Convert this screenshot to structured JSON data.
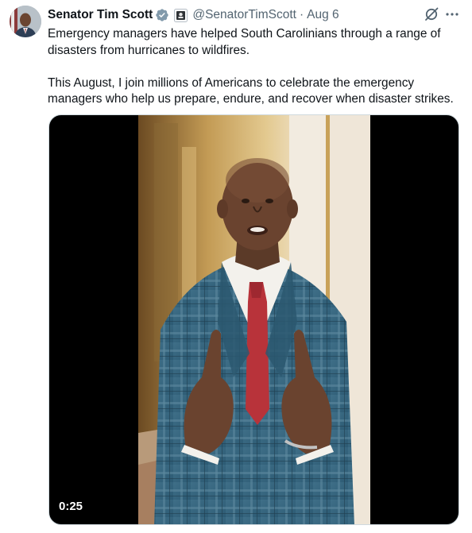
{
  "author": {
    "name": "Senator Tim Scott",
    "handle": "@SenatorTimScott",
    "separator": "·",
    "time": "Aug 6"
  },
  "tweet": {
    "paragraph1": "Emergency managers have helped South Carolinians through a range of disasters from hurricanes to wildfires.",
    "paragraph2": "This August, I join millions of Americans to celebrate the emergency managers who help us prepare, endure, and recover when disaster strikes."
  },
  "video": {
    "duration": "0:25"
  },
  "colors": {
    "verified": "#829aab",
    "text": "#0f1419",
    "secondary": "#536471"
  },
  "icons": [
    "verified-badge-icon",
    "government-affiliation-icon",
    "grok-icon",
    "more-icon"
  ]
}
